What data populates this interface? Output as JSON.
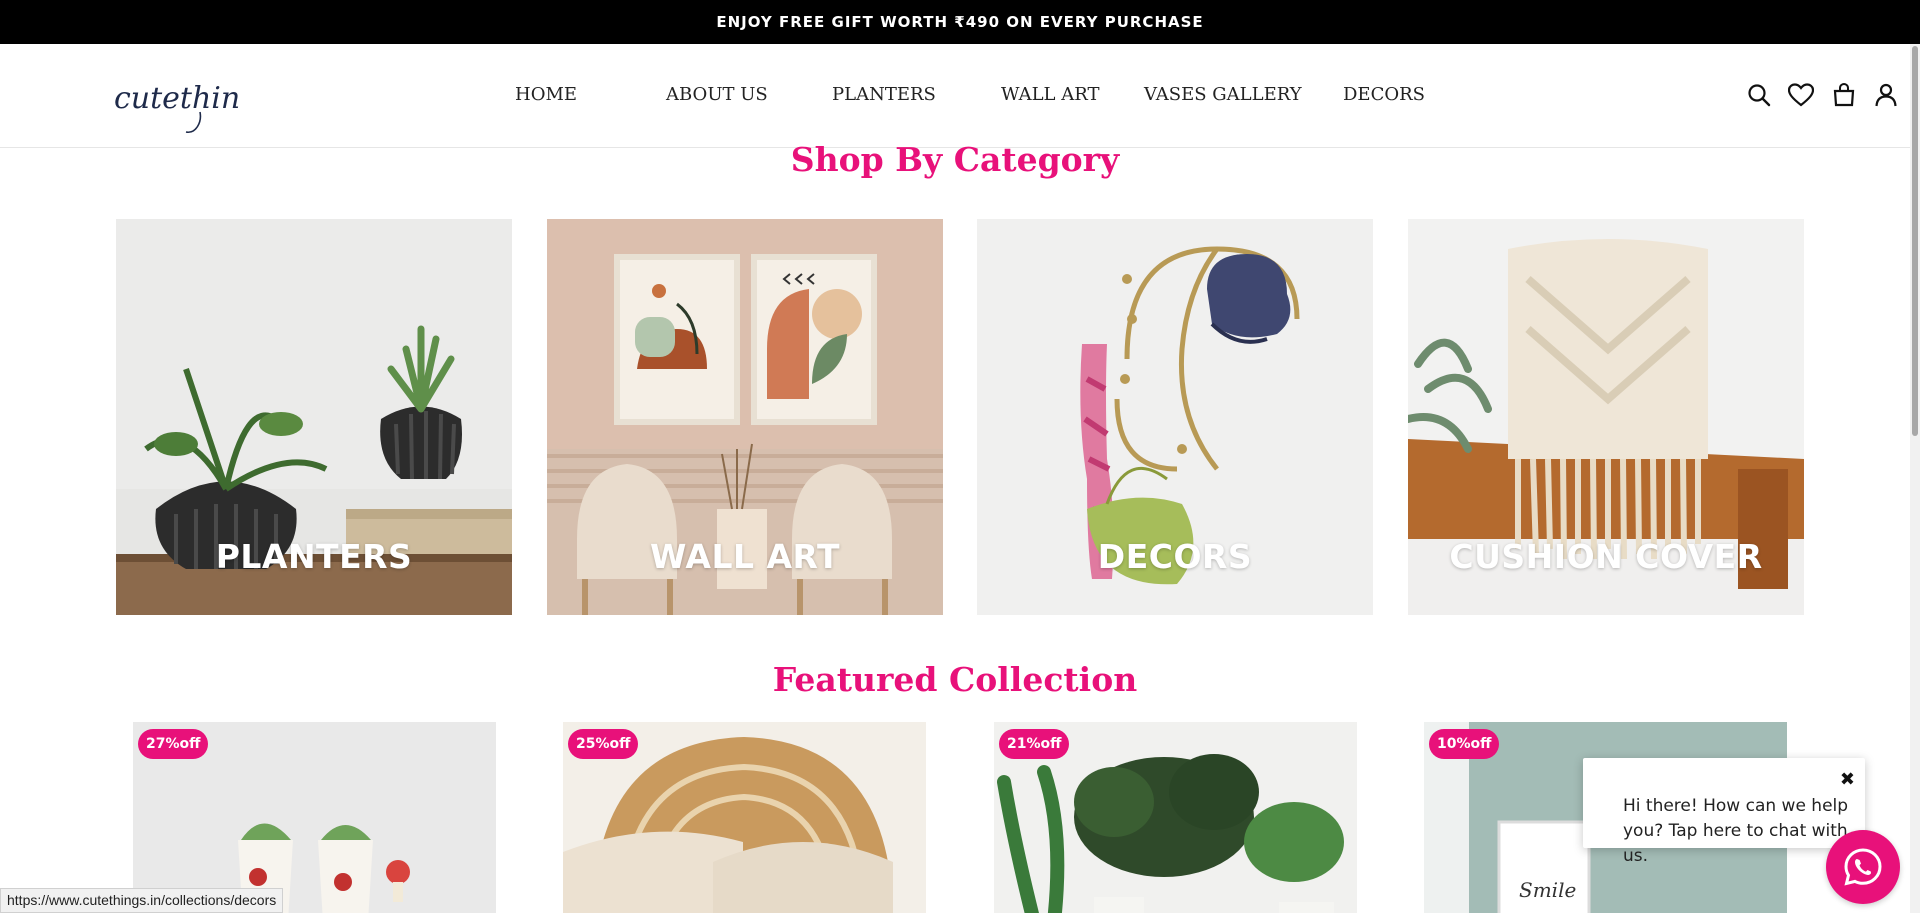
{
  "announcement": "ENJOY FREE GIFT WORTH ₹490 ON EVERY PURCHASE",
  "brand": {
    "logo_text": "cutethings",
    "color": "#1e2a4a"
  },
  "nav": {
    "items": [
      {
        "label": "HOME"
      },
      {
        "label": "ABOUT US"
      },
      {
        "label": "PLANTERS"
      },
      {
        "label": "WALL ART"
      },
      {
        "label": "VASES GALLERY"
      },
      {
        "label": "DECORS"
      }
    ]
  },
  "header_icons": [
    "search-icon",
    "heart-icon",
    "bag-icon",
    "user-icon"
  ],
  "shop_by_category": {
    "title": "Shop By Category",
    "categories": [
      {
        "label": "PLANTERS"
      },
      {
        "label": "WALL ART"
      },
      {
        "label": "DECORS"
      },
      {
        "label": "CUSHION COVER"
      }
    ]
  },
  "featured": {
    "title": "Featured Collection",
    "products": [
      {
        "badge": "27%off"
      },
      {
        "badge": "25%off"
      },
      {
        "badge": "21%off"
      },
      {
        "badge": "10%off"
      }
    ]
  },
  "chat": {
    "message": "Hi there! How can we help you? Tap here to chat with us.",
    "close_symbol": "✖"
  },
  "status_url": "https://www.cutethings.in/collections/decors",
  "colors": {
    "accent": "#e8117a",
    "announcement_bg": "#000000",
    "text": "#222222"
  }
}
